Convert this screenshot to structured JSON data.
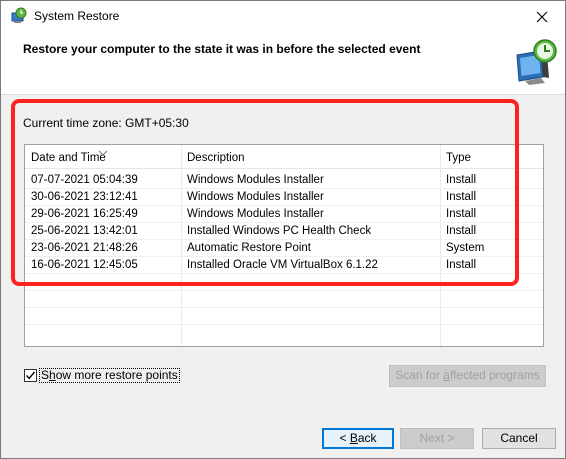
{
  "window": {
    "title": "System Restore",
    "header_title": "Restore your computer to the state it was in before the selected event"
  },
  "timezone": {
    "label": "Current time zone: GMT+05:30"
  },
  "table": {
    "columns": [
      "Date and Time",
      "Description",
      "Type"
    ],
    "rows": [
      [
        "07-07-2021 05:04:39",
        "Windows Modules Installer",
        "Install"
      ],
      [
        "30-06-2021 23:12:41",
        "Windows Modules Installer",
        "Install"
      ],
      [
        "29-06-2021 16:25:49",
        "Windows Modules Installer",
        "Install"
      ],
      [
        "25-06-2021 13:42:01",
        "Installed Windows PC Health Check",
        "Install"
      ],
      [
        "23-06-2021 21:48:26",
        "Automatic Restore Point",
        "System"
      ],
      [
        "16-06-2021 12:45:05",
        "Installed Oracle VM VirtualBox 6.1.22",
        "Install"
      ]
    ]
  },
  "options": {
    "show_more_pre": "S",
    "show_more_u": "h",
    "show_more_post": "ow more restore points",
    "show_more_checked": true
  },
  "buttons": {
    "scan_pre": "Scan for ",
    "scan_u": "a",
    "scan_post": "ffected programs",
    "back_pre": "< ",
    "back_u": "B",
    "back_post": "ack",
    "next": "Next >",
    "cancel": "Cancel"
  },
  "colors": {
    "highlight": "#ff2020",
    "focus": "#0078d7"
  },
  "icons": {
    "title": "system-restore-icon",
    "header": "computer-restore-clock-icon",
    "close": "close-icon",
    "sort": "sort-chevron-down-icon",
    "check": "checkmark-icon"
  }
}
